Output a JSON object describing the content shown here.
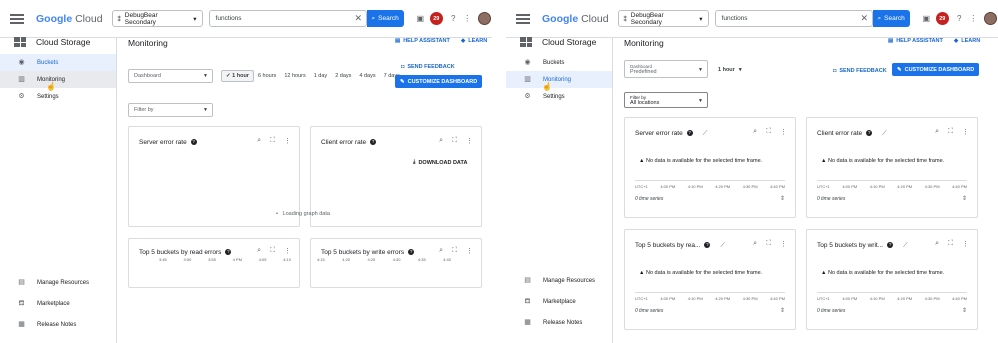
{
  "topbar": {
    "logo_google": "Google",
    "logo_cloud": "Cloud",
    "project": "DebugBear Secondary",
    "search_value": "functions",
    "search_button": "Search",
    "notifications": "29"
  },
  "sidebar": {
    "title": "Cloud Storage",
    "items": [
      "Buckets",
      "Monitoring",
      "Settings"
    ],
    "bottom": [
      "Manage Resources",
      "Marketplace",
      "Release Notes"
    ]
  },
  "left": {
    "page_title": "Monitoring",
    "help_assistant": "HELP ASSISTANT",
    "learn": "LEARN",
    "dashboard_placeholder": "Dashboard",
    "time_ranges": [
      "1 hour",
      "6 hours",
      "12 hours",
      "1 day",
      "2 days",
      "4 days",
      "7 days"
    ],
    "send_feedback": "SEND FEEDBACK",
    "customize": "CUSTOMIZE DASHBOARD",
    "filter_placeholder": "Filter by",
    "card1_title": "Server error rate",
    "card2_title": "Client error rate",
    "download_data": "DOWNLOAD DATA",
    "loading": "Loading graph data",
    "card3_title": "Top 5 buckets by read errors",
    "card4_title": "Top 5 buckets by write errors",
    "card3_ticks": [
      "3:45",
      "3:50",
      "3:55",
      "4 PM",
      "4:05",
      "4:10"
    ],
    "card4_ticks": [
      "4:15",
      "4:20",
      "4:25",
      "4:30",
      "4:35",
      "4:40"
    ]
  },
  "right": {
    "page_title": "Monitoring",
    "help_assistant": "HELP ASSISTANT",
    "learn": "LEARN",
    "dashboard_label": "Dashboard",
    "dashboard_value": "Predefined",
    "time_value": "1 hour",
    "send_feedback": "SEND FEEDBACK",
    "customize": "CUSTOMIZE DASHBOARD",
    "filter_label": "Filter by",
    "filter_value": "All locations",
    "cards": [
      {
        "title": "Server error rate"
      },
      {
        "title": "Client error rate"
      },
      {
        "title": "Top 5 buckets by rea..."
      },
      {
        "title": "Top 5 buckets by writ..."
      }
    ],
    "no_data": "No data is available for the selected time frame.",
    "ticks": [
      "UTC+1",
      "4:00 PM",
      "4:10 PM",
      "4:20 PM",
      "4:30 PM",
      "4:40 PM"
    ],
    "series_count": "0 time series"
  }
}
